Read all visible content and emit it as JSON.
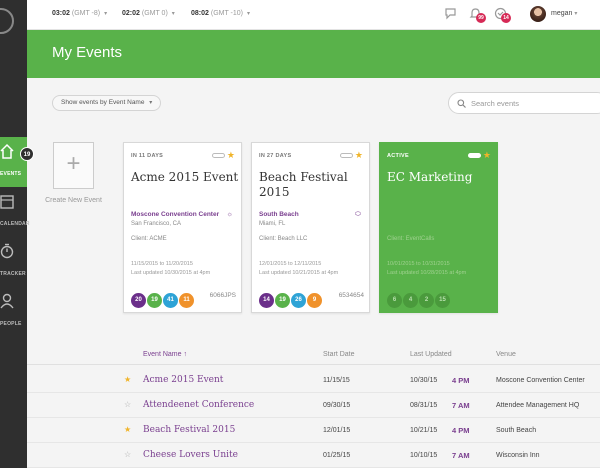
{
  "sidebar": {
    "badge": "19",
    "items": [
      {
        "label": "EVENTS"
      },
      {
        "label": "CALENDAR"
      },
      {
        "label": "TRACKER"
      },
      {
        "label": "PEOPLE"
      }
    ]
  },
  "topbar": {
    "clocks": [
      {
        "time": "03:02",
        "tz": "(GMT -8)"
      },
      {
        "time": "02:02",
        "tz": "(GMT 0)"
      },
      {
        "time": "08:02",
        "tz": "(GMT -10)"
      }
    ],
    "notifications_badge": "99",
    "messages_badge": "14",
    "username": "megan"
  },
  "header": {
    "title": "My Events"
  },
  "filter": {
    "label": "Show events by Event Name"
  },
  "search": {
    "placeholder": "Search events"
  },
  "create": {
    "label": "Create New Event"
  },
  "cards": [
    {
      "days": "IN 11 DAYS",
      "title": "Acme 2015 Event",
      "venue": "Moscone Convention Center",
      "city": "San Francisco, CA",
      "client": "Client: ACME",
      "dates": "11/15/2015 to 11/20/2015",
      "updated": "Last updated 10/30/2015 at 4pm",
      "circles": [
        {
          "value": "20",
          "color": "#6b2f8a"
        },
        {
          "value": "19",
          "color": "#59b24a"
        },
        {
          "value": "41",
          "color": "#2ea3d6"
        },
        {
          "value": "11",
          "color": "#f0922b"
        }
      ],
      "code": "6066JPS"
    },
    {
      "days": "IN 27 DAYS",
      "title": "Beach Festival 2015",
      "venue": "South Beach",
      "city": "Miami, FL",
      "client": "Client: Beach LLC",
      "dates": "12/01/2015 to 12/11/2015",
      "updated": "Last updated 10/21/2015 at 4pm",
      "circles": [
        {
          "value": "14",
          "color": "#6b2f8a"
        },
        {
          "value": "19",
          "color": "#59b24a"
        },
        {
          "value": "26",
          "color": "#2ea3d6"
        },
        {
          "value": "9",
          "color": "#f0922b"
        }
      ],
      "code": "6534654"
    },
    {
      "days": "ACTIVE",
      "title": "EC Marketing",
      "client": "Client: EventCalls",
      "dates": "10/01/2015 to 10/31/2015",
      "updated": "Last updated 10/28/2015 at 4pm",
      "circles": [
        {
          "value": "6"
        },
        {
          "value": "4"
        },
        {
          "value": "2"
        },
        {
          "value": "15"
        }
      ]
    }
  ],
  "table": {
    "columns": {
      "name": "Event Name ↑",
      "start": "Start Date",
      "updated": "Last Updated",
      "venue": "Venue"
    },
    "rows": [
      {
        "starred": true,
        "name": "Acme 2015 Event",
        "start": "11/15/15",
        "updated": "10/30/15",
        "time": "4 PM",
        "venue": "Moscone Convention Center"
      },
      {
        "starred": false,
        "name": "Attendeenet Conference",
        "start": "09/30/15",
        "updated": "08/31/15",
        "time": "7 AM",
        "venue": "Attendee Management HQ"
      },
      {
        "starred": true,
        "name": "Beach Festival 2015",
        "start": "12/01/15",
        "updated": "10/21/15",
        "time": "4 PM",
        "venue": "South Beach"
      },
      {
        "starred": false,
        "name": "Cheese Lovers Unite",
        "start": "01/25/15",
        "updated": "10/10/15",
        "time": "7 AM",
        "venue": "Wisconsin Inn"
      }
    ]
  },
  "colors": {
    "brand_green": "#59b24a",
    "accent_purple": "#7a3f8f",
    "sidebar_dark": "#2f2f2f",
    "star": "#f0b429",
    "badge_red": "#d62a56"
  }
}
